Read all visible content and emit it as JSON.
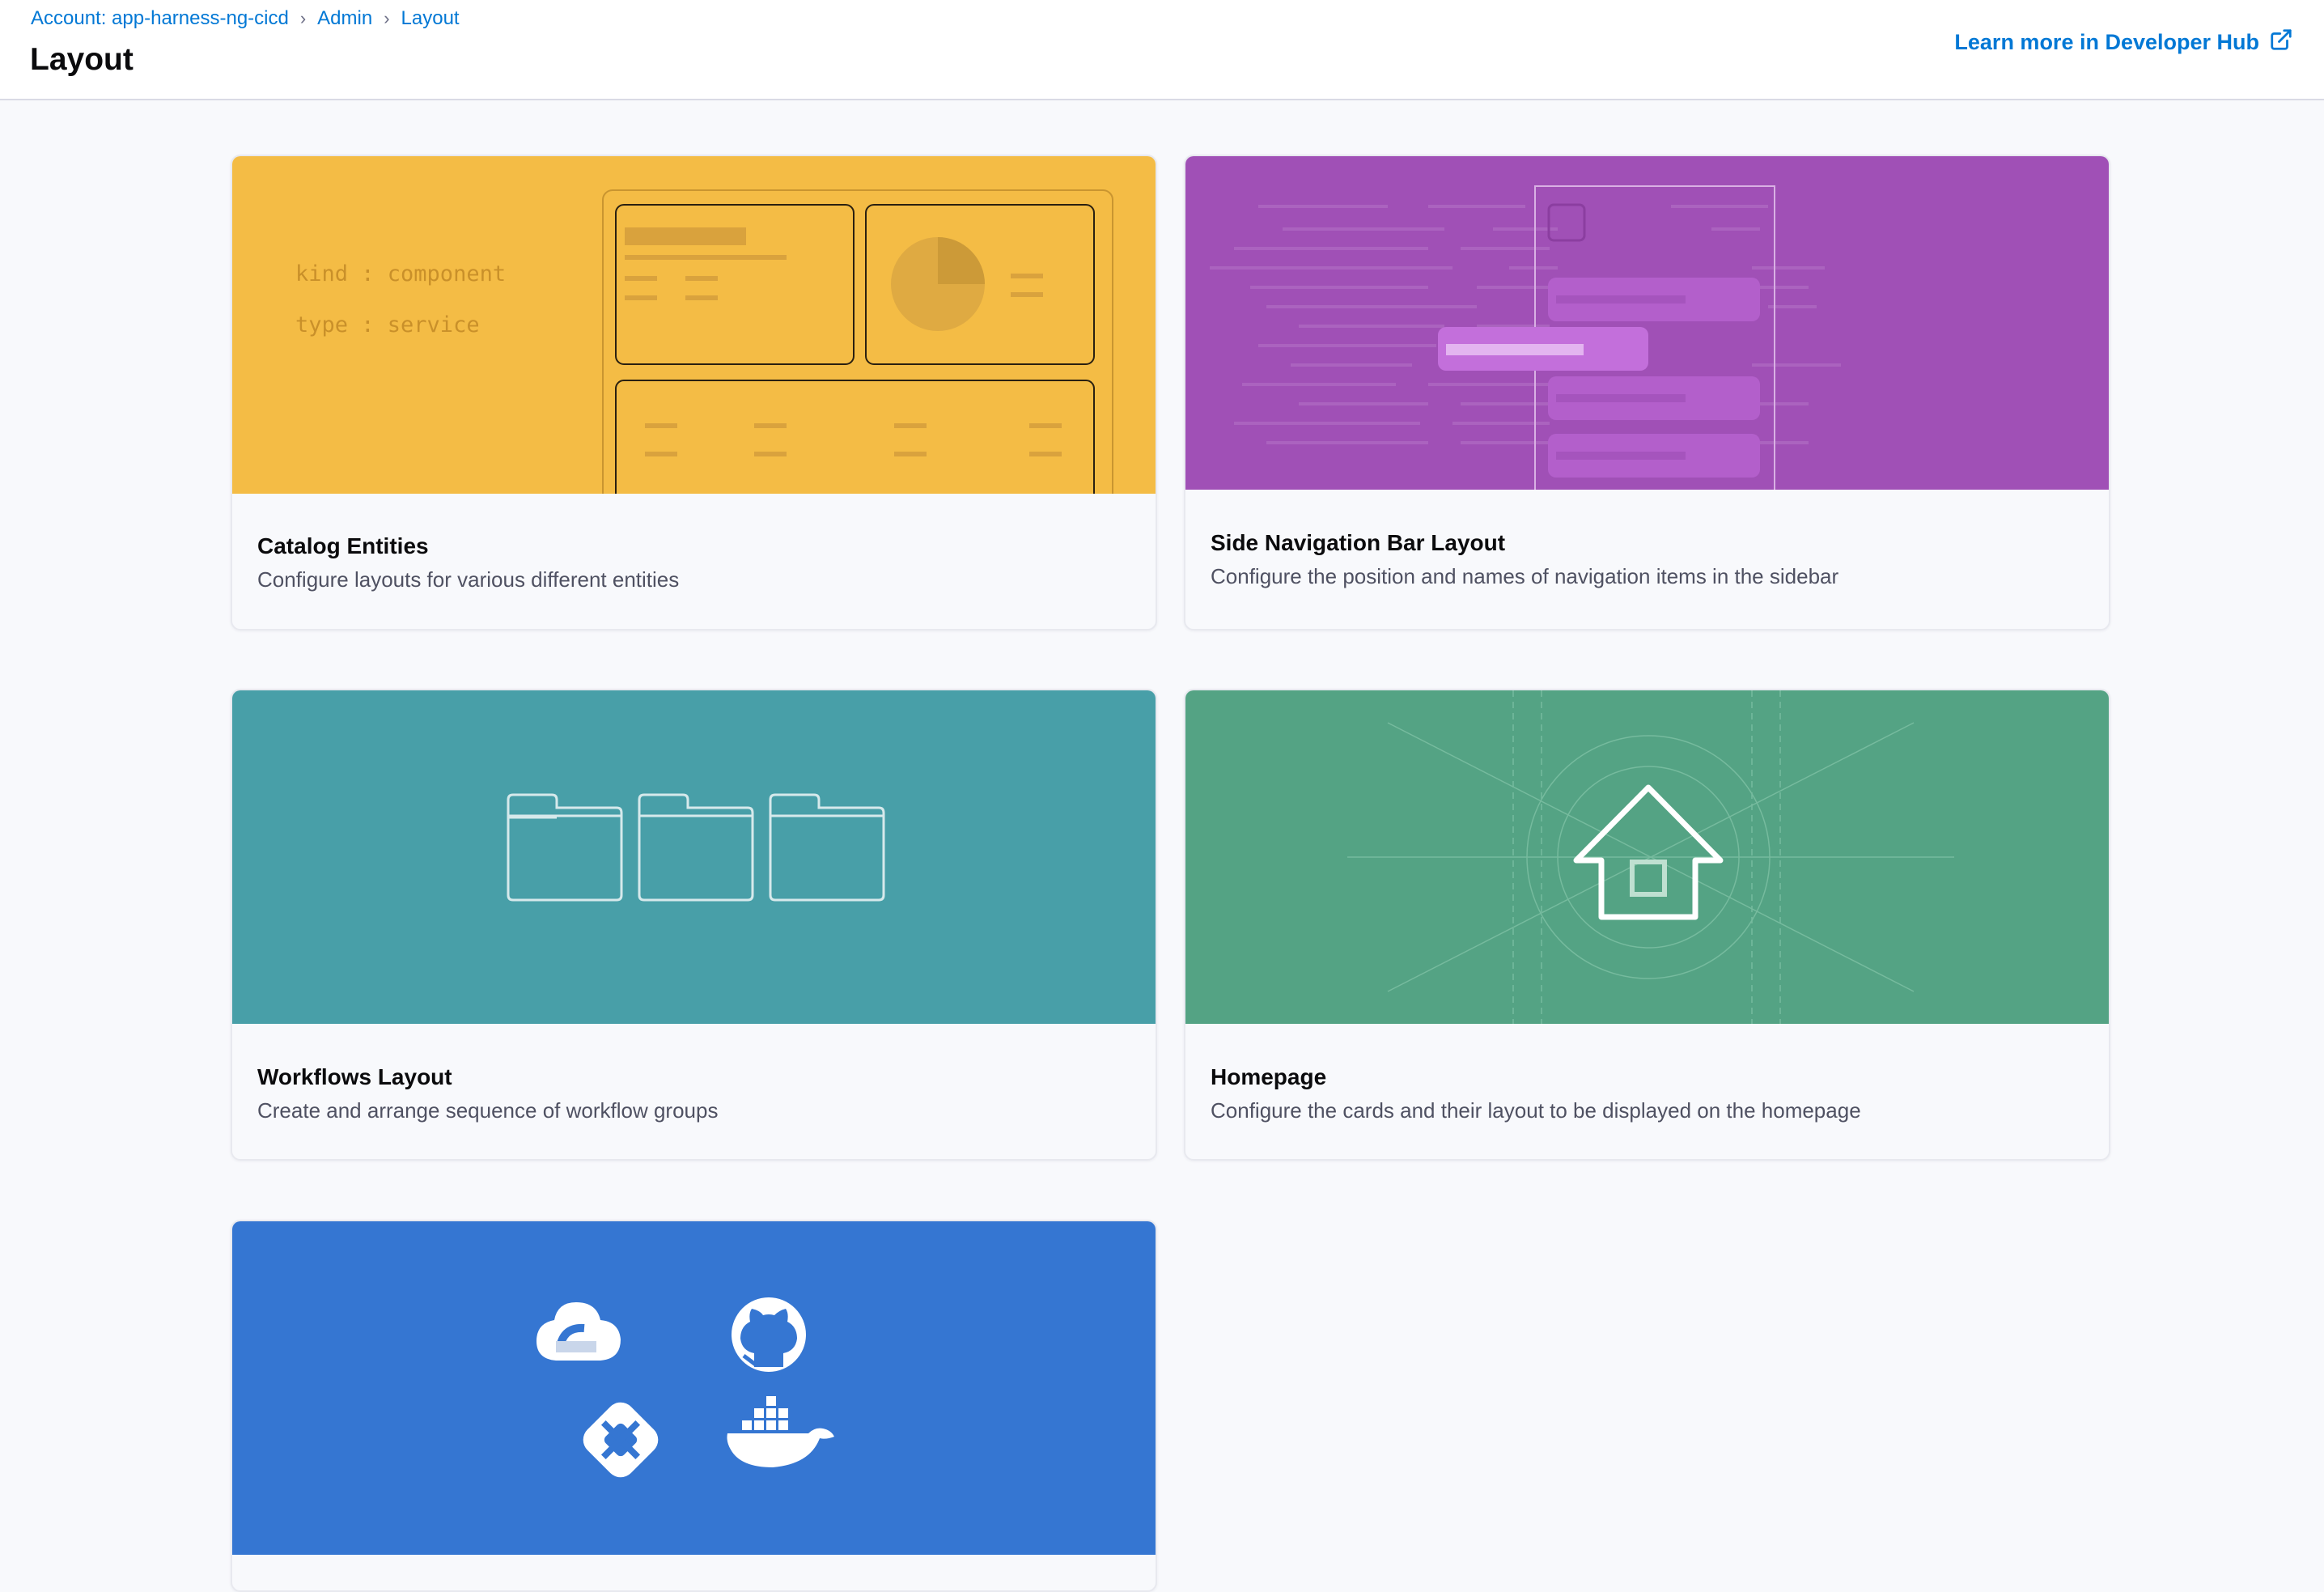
{
  "breadcrumb": {
    "account": "Account: app-harness-ng-cicd",
    "admin": "Admin",
    "layout": "Layout"
  },
  "page": {
    "title": "Layout",
    "learn_more": "Learn more in Developer Hub"
  },
  "cards": [
    {
      "title": "Catalog Entities",
      "description": "Configure layouts for various different entities",
      "color": "#f4bc45",
      "banner_text": [
        "kind : component",
        "type : service"
      ]
    },
    {
      "title": "Side Navigation Bar Layout",
      "description": "Configure the position and names of navigation items in the sidebar",
      "color": "#a050b6"
    },
    {
      "title": "Workflows Layout",
      "description": "Create and arrange sequence of workflow groups",
      "color": "#489fa8"
    },
    {
      "title": "Homepage",
      "description": "Configure the cards and their layout to be displayed on the homepage",
      "color": "#54a384"
    },
    {
      "title": "",
      "description": "",
      "color": "#3576d2",
      "icons": [
        "google-cloud-icon",
        "github-icon",
        "bitbucket-icon",
        "docker-icon"
      ]
    }
  ],
  "colors": {
    "link": "#0278d5",
    "background": "#f8f9fc"
  }
}
